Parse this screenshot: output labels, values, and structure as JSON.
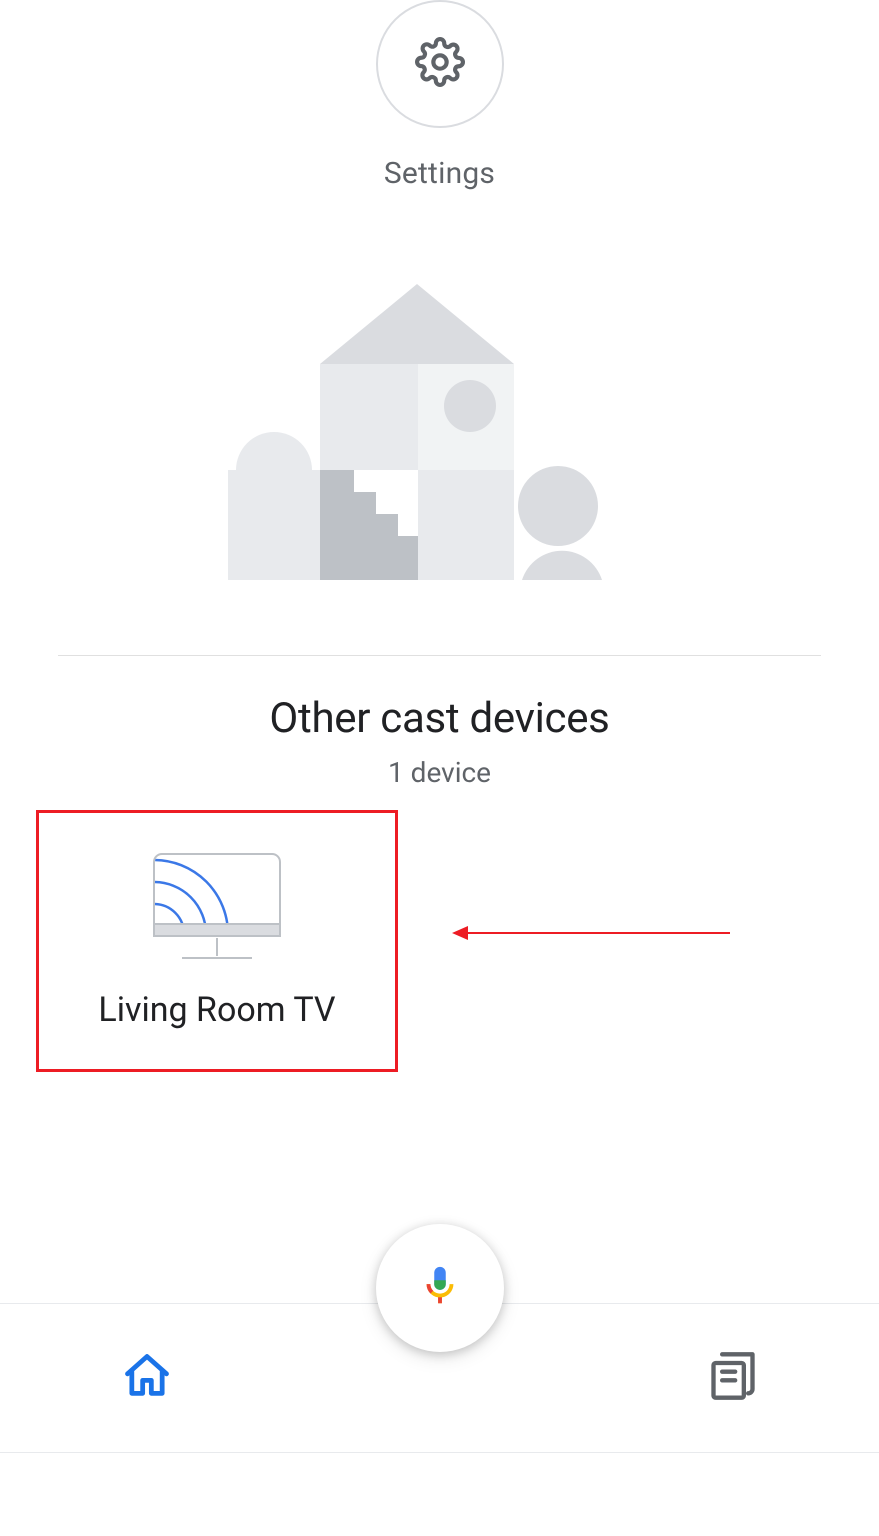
{
  "settings": {
    "label": "Settings"
  },
  "section": {
    "title": "Other cast devices",
    "subtitle": "1 device"
  },
  "devices": [
    {
      "name": "Living Room TV",
      "icon": "cast-tv-icon"
    }
  ],
  "nav": {
    "home": "home-icon",
    "activity": "feed-icon"
  },
  "colors": {
    "highlight": "#ed1c24",
    "google_blue": "#1a73e8",
    "grey": "#5f6368"
  }
}
